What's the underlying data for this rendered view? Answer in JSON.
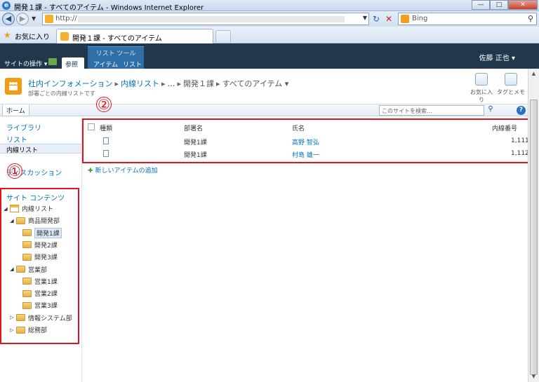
{
  "window": {
    "title": "開発１課 - すべてのアイテム - Windows Internet Explorer",
    "controls": [
      "—",
      "□",
      "✕"
    ]
  },
  "addressbar": {
    "url": "http://",
    "search_engine": "Bing"
  },
  "tabs": {
    "favorites_label": "お気に入り",
    "active_tab": "開発１課 - すべてのアイテム"
  },
  "ribbon": {
    "site_actions": "サイトの操作",
    "browse_tab": "参照",
    "tool_group": "リスト ツール",
    "item_tab": "アイテム",
    "list_tab": "リスト",
    "user": "佐藤 正也"
  },
  "titlearea": {
    "breadcrumb": [
      "社内インフォメーション",
      "内線リスト",
      "…",
      "開発１課",
      "すべてのアイテム"
    ],
    "description": "部署ごとの内線リストです",
    "like_label": "お気に入り",
    "tags_label": "タグとメモ"
  },
  "topbar": {
    "home": "ホーム",
    "search_placeholder": "このサイトを検索..."
  },
  "quicklaunch": {
    "libraries": "ライブラリ",
    "lists": "リスト",
    "selected_list": "内線リスト",
    "discussions": "ディスカッション",
    "tree_heading": "サイト コンテンツ",
    "tree": [
      {
        "label": "内線リスト",
        "level": 0,
        "toggle": "◢",
        "type": "list"
      },
      {
        "label": "商品開発部",
        "level": 1,
        "toggle": "◢",
        "type": "folder"
      },
      {
        "label": "開発1課",
        "level": 2,
        "toggle": "",
        "type": "folder",
        "selected": true
      },
      {
        "label": "開発2課",
        "level": 2,
        "toggle": "",
        "type": "folder"
      },
      {
        "label": "開発3課",
        "level": 2,
        "toggle": "",
        "type": "folder"
      },
      {
        "label": "営業部",
        "level": 1,
        "toggle": "◢",
        "type": "folder"
      },
      {
        "label": "営業1課",
        "level": 2,
        "toggle": "",
        "type": "folder"
      },
      {
        "label": "営業2課",
        "level": 2,
        "toggle": "",
        "type": "folder"
      },
      {
        "label": "営業3課",
        "level": 2,
        "toggle": "",
        "type": "folder"
      },
      {
        "label": "情報システム部",
        "level": 1,
        "toggle": "▷",
        "type": "folder"
      },
      {
        "label": "総務部",
        "level": 1,
        "toggle": "▷",
        "type": "folder"
      }
    ]
  },
  "list": {
    "columns": [
      "種類",
      "部署名",
      "氏名",
      "内線番号"
    ],
    "rows": [
      {
        "dept": "開発1課",
        "name": "高野 智弘",
        "ext": "1,111"
      },
      {
        "dept": "開発1課",
        "name": "村島 雄一",
        "ext": "1,112"
      }
    ],
    "add_item": "新しいアイテムの追加"
  },
  "annotations": {
    "one": "①",
    "two": "②"
  },
  "colors": {
    "ribbon_bg": "#21374c",
    "link": "#0072bc",
    "annotation": "#e0141e"
  }
}
